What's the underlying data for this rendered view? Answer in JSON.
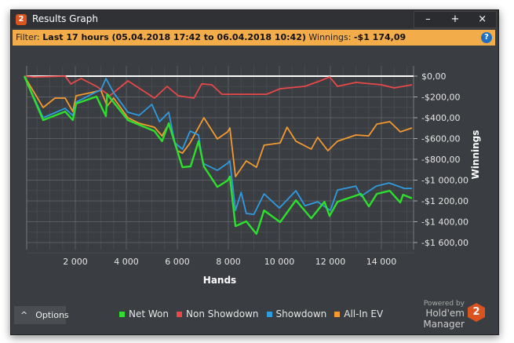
{
  "window": {
    "title": "Results Graph",
    "controls": [
      "–",
      "+",
      "×"
    ]
  },
  "filter": {
    "label": "Filter:",
    "range": "Last 17 hours (05.04.2018 17:42 to 06.04.2018 10:42)",
    "winnings_label": "Winnings:",
    "winnings_value": "-$1 174,09",
    "help": "?"
  },
  "options_label": "Options",
  "powered": {
    "line1": "Powered by",
    "line2": "Hold'em Manager",
    "logo": "2"
  },
  "chart_data": {
    "type": "line",
    "xlabel": "Hands",
    "ylabel": "Winnings",
    "xlim": [
      0,
      15200
    ],
    "ylim": [
      -1700,
      100
    ],
    "xticks": [
      2000,
      4000,
      6000,
      8000,
      10000,
      12000,
      14000
    ],
    "xtick_labels": [
      "2 000",
      "4 000",
      "6 000",
      "8 000",
      "10 000",
      "12 000",
      "14 000"
    ],
    "yticks": [
      0,
      -200,
      -400,
      -600,
      -800,
      -1000,
      -1200,
      -1400,
      -1600
    ],
    "ytick_labels": [
      "$0,00",
      "-$200,00",
      "-$400,00",
      "-$600,00",
      "-$800,00",
      "-$1 000,00",
      "-$1 200,00",
      "-$1 400,00",
      "-$1 600,00"
    ],
    "grid": true,
    "legend_placement": "bottom",
    "series": [
      {
        "name": "Non Showdown",
        "color": "#e84848",
        "points": [
          [
            0,
            0
          ],
          [
            370,
            -8
          ],
          [
            1600,
            0
          ],
          [
            1820,
            -75
          ],
          [
            2220,
            -23
          ],
          [
            2830,
            -98
          ],
          [
            3350,
            -189
          ],
          [
            4060,
            -45
          ],
          [
            5100,
            -211
          ],
          [
            5600,
            -98
          ],
          [
            6030,
            -189
          ],
          [
            6650,
            -211
          ],
          [
            6950,
            -75
          ],
          [
            7350,
            -83
          ],
          [
            7750,
            -174
          ],
          [
            9500,
            -174
          ],
          [
            10030,
            -121
          ],
          [
            11000,
            -98
          ],
          [
            11600,
            -45
          ],
          [
            11970,
            -8
          ],
          [
            12280,
            -98
          ],
          [
            13000,
            -60
          ],
          [
            14000,
            -83
          ],
          [
            14500,
            -113
          ],
          [
            15200,
            -83
          ]
        ]
      },
      {
        "name": "All-In EV",
        "color": "#f29a30",
        "points": [
          [
            0,
            0
          ],
          [
            740,
            -302
          ],
          [
            1200,
            -211
          ],
          [
            1600,
            -211
          ],
          [
            1900,
            -340
          ],
          [
            2030,
            -189
          ],
          [
            2600,
            -159
          ],
          [
            3000,
            -136
          ],
          [
            3250,
            -287
          ],
          [
            3500,
            -211
          ],
          [
            4060,
            -400
          ],
          [
            4500,
            -453
          ],
          [
            5100,
            -491
          ],
          [
            5400,
            -574
          ],
          [
            5660,
            -461
          ],
          [
            6000,
            -717
          ],
          [
            6200,
            -740
          ],
          [
            6500,
            -642
          ],
          [
            7040,
            -400
          ],
          [
            7570,
            -604
          ],
          [
            7970,
            -536
          ],
          [
            8060,
            -498
          ],
          [
            8280,
            -966
          ],
          [
            8700,
            -815
          ],
          [
            9100,
            -876
          ],
          [
            9400,
            -664
          ],
          [
            10030,
            -642
          ],
          [
            10300,
            -491
          ],
          [
            10650,
            -626
          ],
          [
            11250,
            -702
          ],
          [
            11500,
            -589
          ],
          [
            11900,
            -717
          ],
          [
            12280,
            -626
          ],
          [
            13000,
            -566
          ],
          [
            13500,
            -574
          ],
          [
            13820,
            -461
          ],
          [
            14330,
            -438
          ],
          [
            14740,
            -536
          ],
          [
            15200,
            -498
          ]
        ]
      },
      {
        "name": "Showdown",
        "color": "#2f9be0",
        "points": [
          [
            0,
            0
          ],
          [
            740,
            -400
          ],
          [
            1600,
            -310
          ],
          [
            1900,
            -380
          ],
          [
            2030,
            -250
          ],
          [
            2830,
            -150
          ],
          [
            3000,
            -136
          ],
          [
            3200,
            -23
          ],
          [
            3500,
            -159
          ],
          [
            4060,
            -347
          ],
          [
            4500,
            -377
          ],
          [
            5000,
            -272
          ],
          [
            5300,
            -438
          ],
          [
            5660,
            -347
          ],
          [
            5900,
            -642
          ],
          [
            6200,
            -702
          ],
          [
            6500,
            -528
          ],
          [
            6830,
            -566
          ],
          [
            7000,
            -838
          ],
          [
            7570,
            -906
          ],
          [
            7970,
            -838
          ],
          [
            8060,
            -815
          ],
          [
            8280,
            -1291
          ],
          [
            8500,
            -1117
          ],
          [
            8700,
            -1321
          ],
          [
            9000,
            -1329
          ],
          [
            9400,
            -1132
          ],
          [
            10000,
            -1268
          ],
          [
            10650,
            -1102
          ],
          [
            11000,
            -1246
          ],
          [
            11500,
            -1208
          ],
          [
            12000,
            -1291
          ],
          [
            12280,
            -1095
          ],
          [
            13000,
            -1057
          ],
          [
            13200,
            -1155
          ],
          [
            13800,
            -1057
          ],
          [
            14300,
            -1027
          ],
          [
            14900,
            -1080
          ],
          [
            15200,
            -1080
          ]
        ]
      },
      {
        "name": "Net Won",
        "color": "#2ee02e",
        "points": [
          [
            0,
            0
          ],
          [
            740,
            -423
          ],
          [
            1600,
            -340
          ],
          [
            1900,
            -423
          ],
          [
            2030,
            -264
          ],
          [
            2830,
            -196
          ],
          [
            3200,
            -385
          ],
          [
            3250,
            -174
          ],
          [
            4060,
            -423
          ],
          [
            5100,
            -528
          ],
          [
            5400,
            -626
          ],
          [
            5660,
            -453
          ],
          [
            6200,
            -876
          ],
          [
            6520,
            -868
          ],
          [
            6830,
            -626
          ],
          [
            7040,
            -868
          ],
          [
            7570,
            -1065
          ],
          [
            7970,
            -1004
          ],
          [
            8060,
            -966
          ],
          [
            8280,
            -1442
          ],
          [
            8700,
            -1396
          ],
          [
            9100,
            -1517
          ],
          [
            9400,
            -1291
          ],
          [
            10030,
            -1404
          ],
          [
            10650,
            -1193
          ],
          [
            11250,
            -1367
          ],
          [
            11770,
            -1208
          ],
          [
            11970,
            -1344
          ],
          [
            12280,
            -1208
          ],
          [
            13200,
            -1132
          ],
          [
            13510,
            -1253
          ],
          [
            13820,
            -1132
          ],
          [
            14330,
            -1102
          ],
          [
            14740,
            -1215
          ],
          [
            14850,
            -1140
          ],
          [
            15200,
            -1174.09
          ]
        ]
      }
    ]
  }
}
